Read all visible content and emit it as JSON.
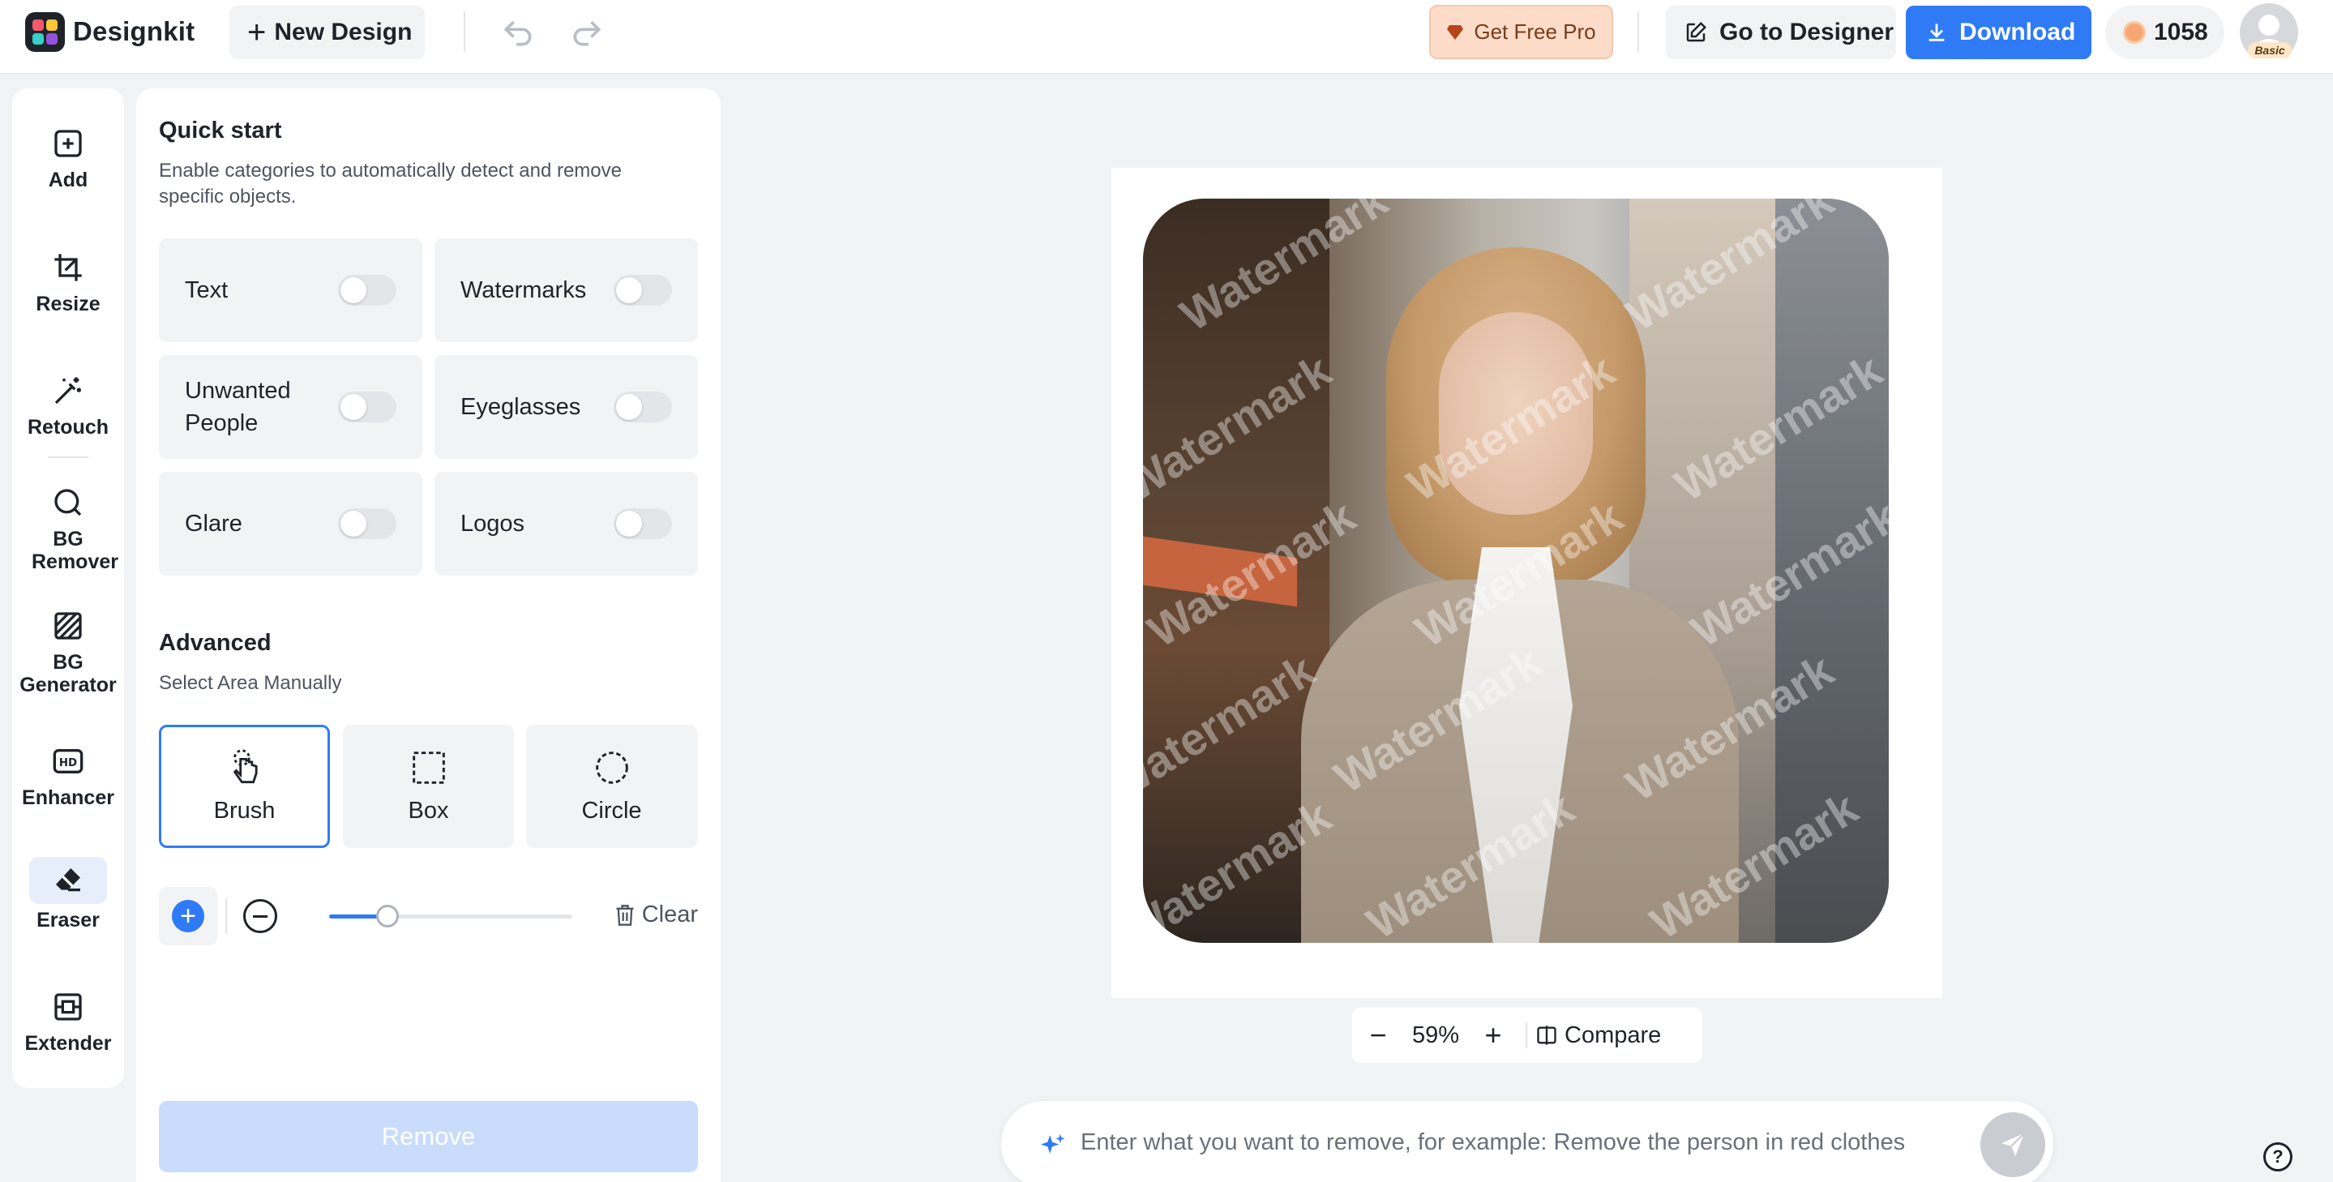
{
  "header": {
    "brand": "Designkit",
    "new_design": "New Design",
    "get_pro": "Get Free Pro",
    "go_to_designer": "Go to Designer",
    "download": "Download",
    "credits": "1058",
    "plan_badge": "Basic"
  },
  "rail": {
    "items": [
      {
        "label": "Add",
        "icon": "add-square-icon"
      },
      {
        "label": "Resize",
        "icon": "crop-icon"
      },
      {
        "label": "Retouch",
        "icon": "magic-wand-icon"
      },
      {
        "label": "BG Remover",
        "icon": "bg-remover-icon"
      },
      {
        "label": "BG Generator",
        "icon": "bg-generator-icon"
      },
      {
        "label": "Enhancer",
        "icon": "hd-icon"
      },
      {
        "label": "Eraser",
        "icon": "eraser-icon"
      },
      {
        "label": "Extender",
        "icon": "extender-icon"
      }
    ],
    "active": "Eraser"
  },
  "panel": {
    "quick_start_title": "Quick start",
    "quick_start_desc": "Enable categories to automatically detect and remove specific objects.",
    "categories": [
      {
        "label": "Text",
        "enabled": false
      },
      {
        "label": "Watermarks",
        "enabled": false
      },
      {
        "label": "Unwanted People",
        "enabled": false
      },
      {
        "label": "Eyeglasses",
        "enabled": false
      },
      {
        "label": "Glare",
        "enabled": false
      },
      {
        "label": "Logos",
        "enabled": false
      }
    ],
    "advanced_title": "Advanced",
    "advanced_desc": "Select Area Manually",
    "modes": [
      {
        "label": "Brush",
        "active": true
      },
      {
        "label": "Box",
        "active": false
      },
      {
        "label": "Circle",
        "active": false
      }
    ],
    "brush_size_percent": 24,
    "clear_label": "Clear",
    "remove_label": "Remove"
  },
  "canvas": {
    "watermark_text": "Watermark",
    "zoom": "59%",
    "compare_label": "Compare"
  },
  "prompt": {
    "placeholder": "Enter what you want to remove, for example: Remove the person in red clothes"
  },
  "colors": {
    "accent": "#2f7bf5",
    "pro_bg": "#fcdcc9",
    "remove_disabled": "#c9dcfb"
  }
}
